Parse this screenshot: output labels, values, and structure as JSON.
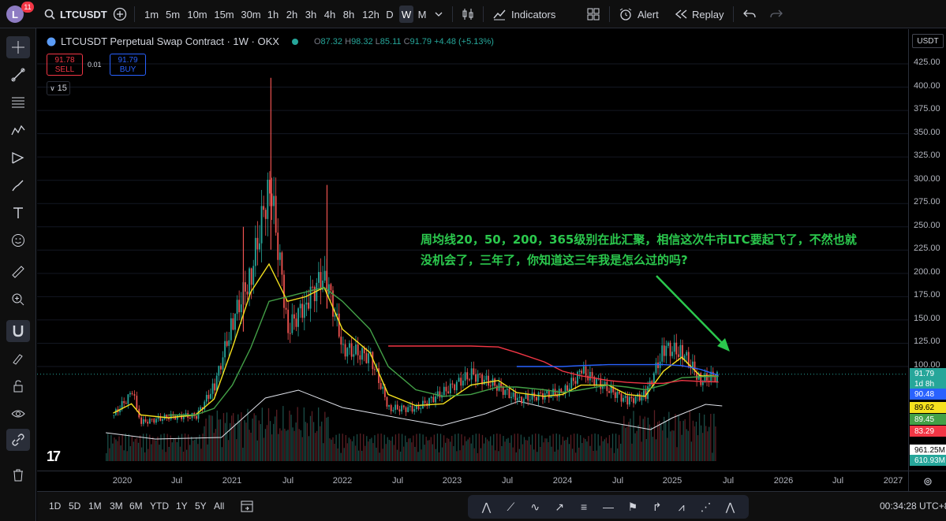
{
  "toolbar": {
    "notification_count": "11",
    "avatar_letter": "L",
    "symbol": "LTCUSDT",
    "timeframes": [
      "1m",
      "5m",
      "10m",
      "15m",
      "30m",
      "1h",
      "2h",
      "3h",
      "4h",
      "8h",
      "12h",
      "D",
      "W",
      "M"
    ],
    "active_timeframe": "W",
    "indicators_label": "Indicators",
    "alert_label": "Alert",
    "replay_label": "Replay"
  },
  "legend": {
    "title": "LTCUSDT Perpetual Swap Contract · 1W · OKX",
    "open_label": "O",
    "open": "87.32",
    "high_label": "H",
    "high": "98.32",
    "low_label": "L",
    "low": "85.11",
    "close_label": "C",
    "close": "91.79",
    "change": "+4.48 (+5.13%)"
  },
  "trade": {
    "sell_price": "91.78",
    "sell_label": "SELL",
    "spread": "0.01",
    "buy_price": "91.79",
    "buy_label": "BUY",
    "indicator_count": "15"
  },
  "annotation": {
    "line1": "周均线20，50，200，365级别在此汇聚，相信这次牛市LTC要起飞了，不然也就",
    "line2": "没机会了，三年了，你知道这三年我是怎么过的吗?"
  },
  "price_axis": {
    "currency": "USDT",
    "labels": [
      "425.00",
      "400.00",
      "375.00",
      "350.00",
      "325.00",
      "300.00",
      "275.00",
      "250.00",
      "225.00",
      "200.00",
      "175.00",
      "150.00",
      "125.00",
      "100.00"
    ],
    "tags": [
      {
        "text": "91.79",
        "color": "#26a69a"
      },
      {
        "text": "1d 8h",
        "color": "#26a69a"
      },
      {
        "text": "90.48",
        "color": "#2962ff"
      },
      {
        "text": "89.62",
        "color": "#f5e11e"
      },
      {
        "text": "89.45",
        "color": "#43a047"
      },
      {
        "text": "83.29",
        "color": "#f23645"
      },
      {
        "text": "961.25M",
        "color": "#ffffff"
      },
      {
        "text": "610.93M",
        "color": "#26a69a"
      }
    ]
  },
  "time_axis": {
    "labels": [
      "2020",
      "Jul",
      "2021",
      "Jul",
      "2022",
      "Jul",
      "2023",
      "Jul",
      "2024",
      "Jul",
      "2025",
      "Jul",
      "2026",
      "Jul",
      "2027"
    ]
  },
  "bottom": {
    "ranges": [
      "1D",
      "5D",
      "1M",
      "3M",
      "6M",
      "YTD",
      "1Y",
      "5Y",
      "All"
    ],
    "clock": "00:34:28 UTC+8"
  },
  "chart_data": {
    "type": "candlestick",
    "title": "LTCUSDT Perpetual Swap Contract · 1W · OKX",
    "ylim": [
      75,
      440
    ],
    "x_range": [
      "2019-11",
      "2027-02"
    ],
    "series": [
      {
        "name": "close",
        "x": [
          "2019-12",
          "2020-02",
          "2020-03",
          "2020-06",
          "2020-09",
          "2020-11",
          "2021-01",
          "2021-03",
          "2021-05",
          "2021-07",
          "2021-09",
          "2021-11",
          "2022-01",
          "2022-04",
          "2022-06",
          "2022-09",
          "2022-12",
          "2023-03",
          "2023-06",
          "2023-08",
          "2023-11",
          "2024-01",
          "2024-03",
          "2024-06",
          "2024-08",
          "2024-10",
          "2024-12",
          "2025-02",
          "2025-04",
          "2025-06"
        ],
        "values": [
          48,
          72,
          40,
          46,
          47,
          80,
          150,
          200,
          300,
          140,
          170,
          200,
          120,
          110,
          55,
          55,
          73,
          92,
          78,
          64,
          70,
          72,
          95,
          75,
          63,
          70,
          120,
          115,
          85,
          91.79
        ]
      },
      {
        "name": "ma20",
        "values": [
          50,
          60,
          48,
          45,
          48,
          65,
          120,
          180,
          210,
          170,
          175,
          185,
          140,
          115,
          70,
          58,
          60,
          80,
          85,
          72,
          68,
          70,
          80,
          80,
          70,
          68,
          95,
          110,
          90,
          89.62
        ]
      },
      {
        "name": "ma50",
        "values": [
          null,
          null,
          null,
          48,
          48,
          55,
          80,
          120,
          170,
          175,
          180,
          185,
          170,
          140,
          100,
          75,
          68,
          70,
          78,
          78,
          75,
          72,
          75,
          80,
          78,
          75,
          80,
          88,
          89,
          89.45
        ]
      },
      {
        "name": "ma200",
        "values": [
          null,
          null,
          null,
          null,
          null,
          null,
          null,
          null,
          null,
          null,
          null,
          null,
          null,
          null,
          122,
          122,
          122,
          122,
          121,
          115,
          105,
          95,
          90,
          85,
          83,
          82,
          82,
          85,
          84,
          83.29
        ]
      },
      {
        "name": "ma365",
        "values": [
          null,
          null,
          null,
          null,
          null,
          null,
          null,
          null,
          null,
          null,
          null,
          null,
          null,
          null,
          null,
          null,
          null,
          null,
          null,
          100,
          100,
          100,
          101,
          102,
          102,
          102,
          102,
          101,
          97,
          90.48
        ]
      }
    ],
    "volume": {
      "last": "961.25M",
      "current": "610.93M"
    }
  }
}
